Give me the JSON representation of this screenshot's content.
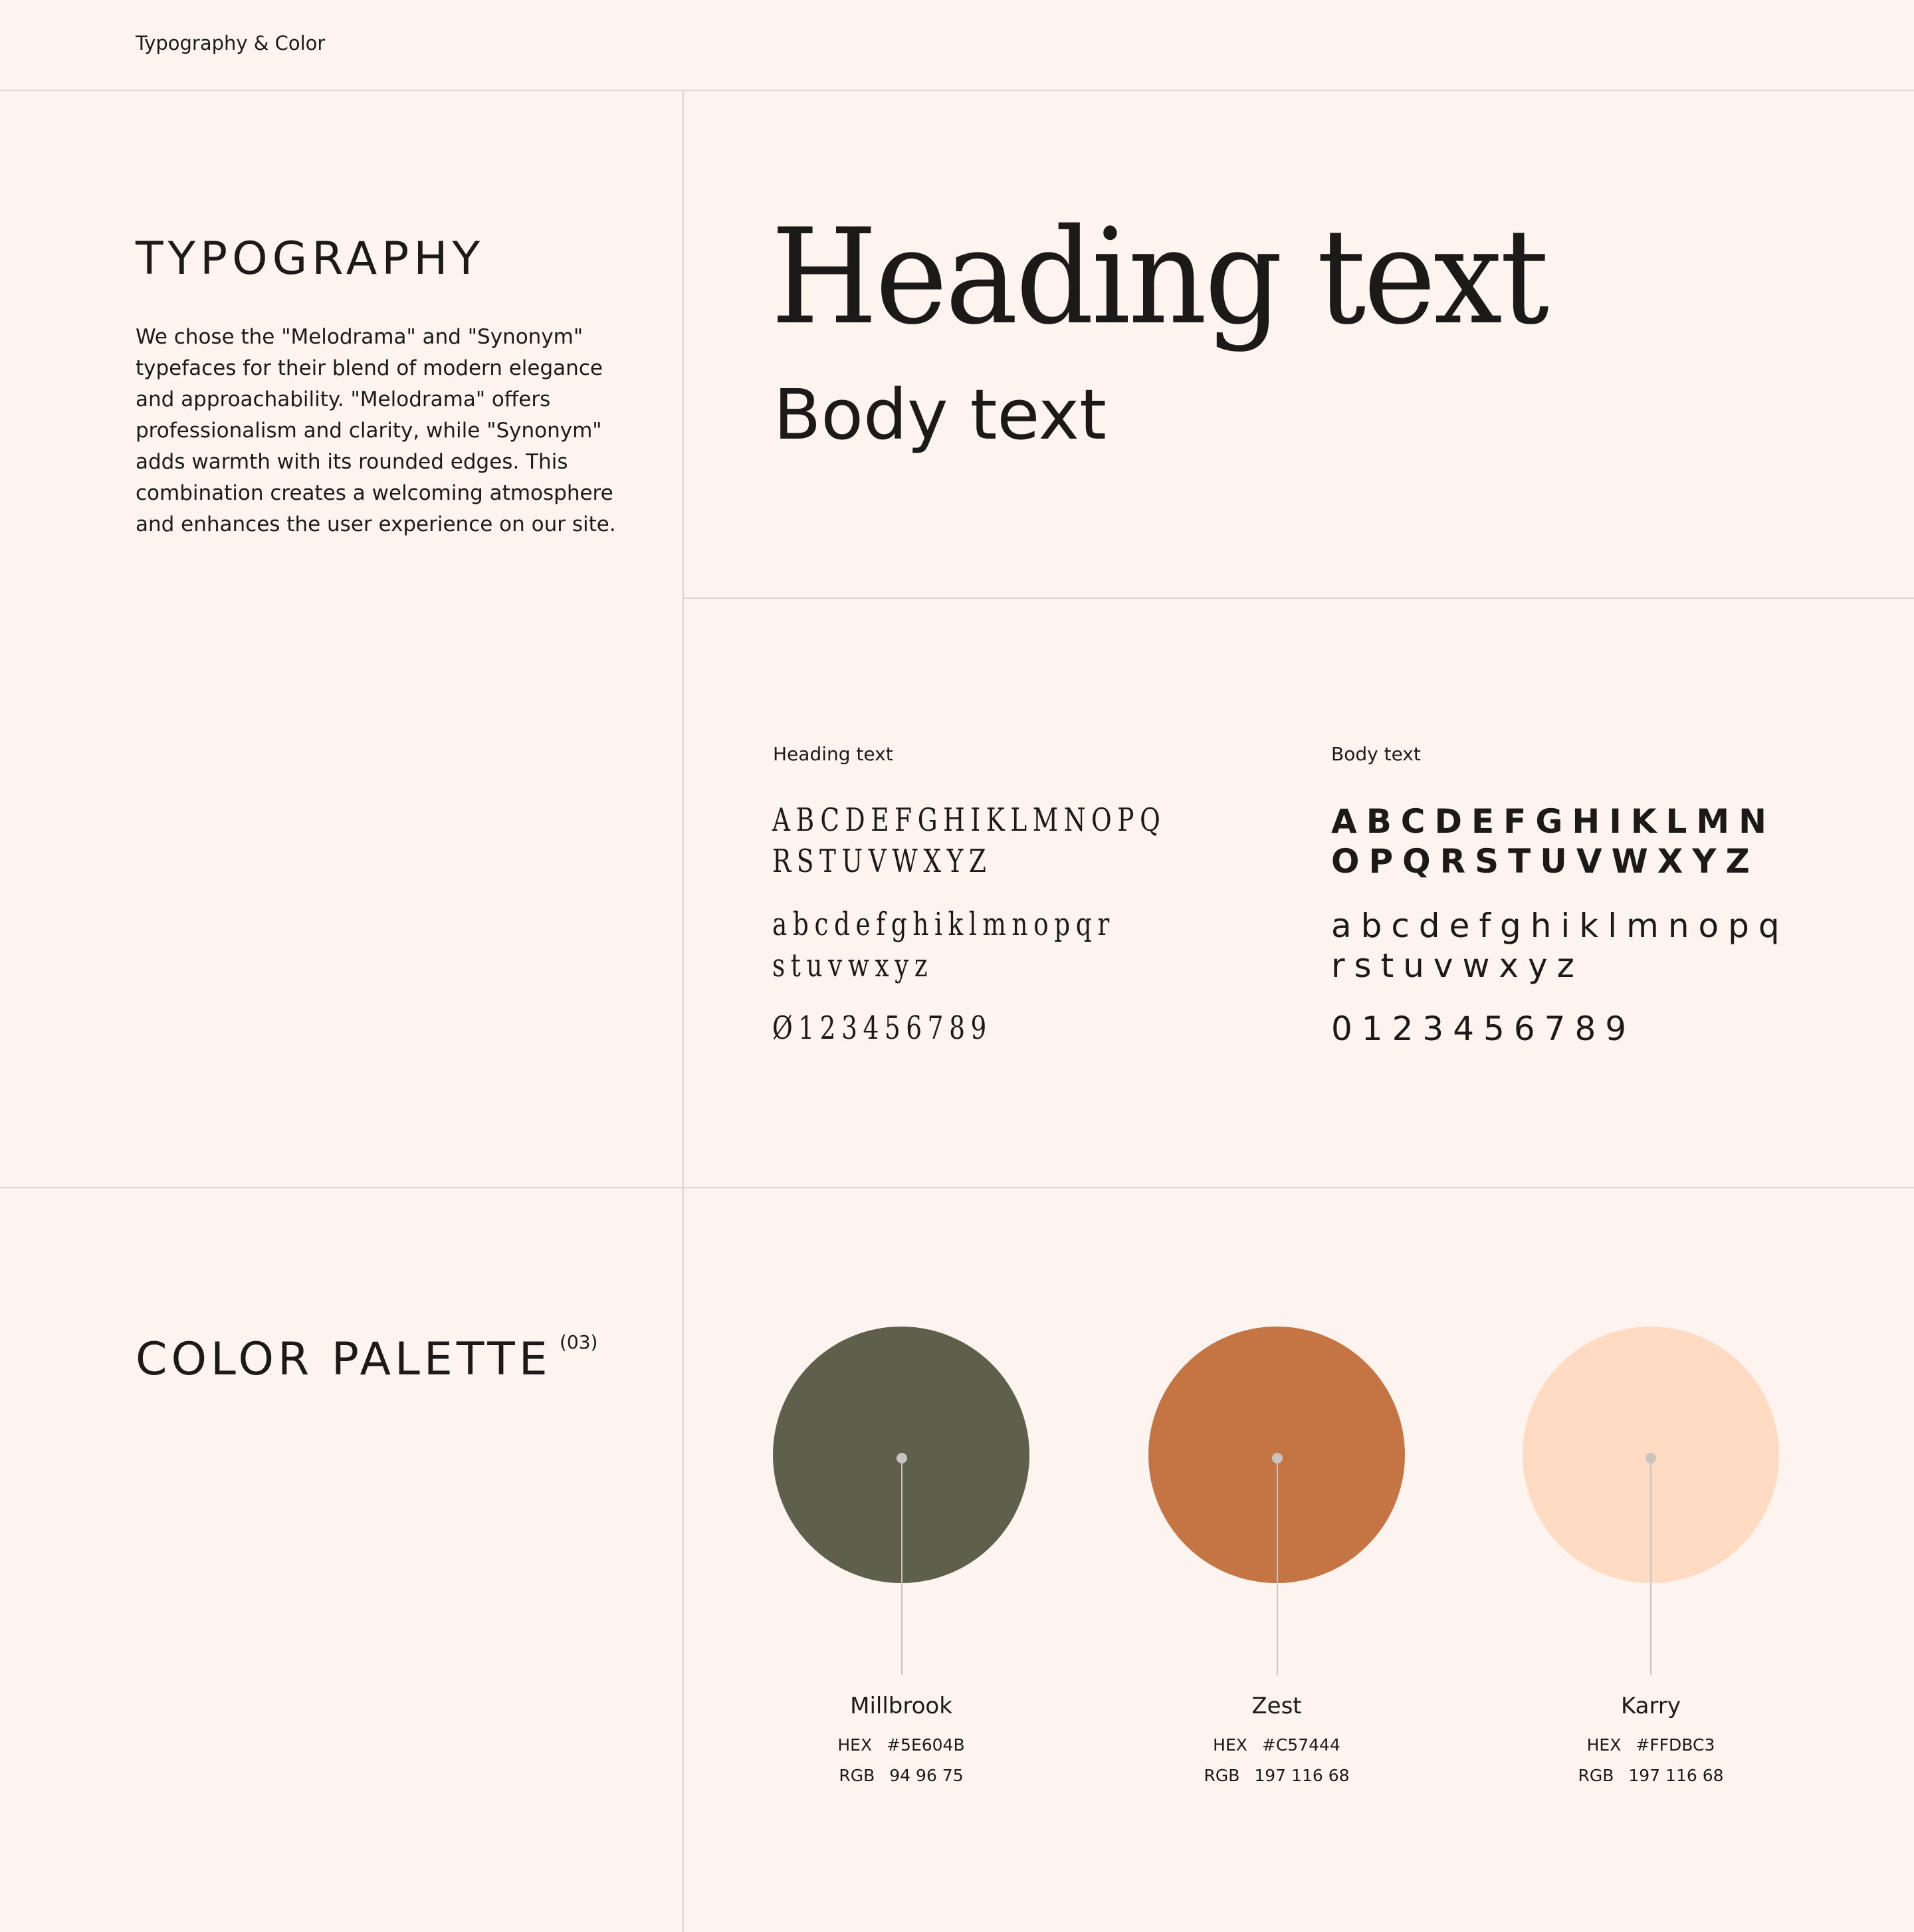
{
  "header": {
    "title": "Typography & Color"
  },
  "typography": {
    "title": "TYPOGRAPHY",
    "description": "We chose the \"Melodrama\" and \"Synonym\" typefaces for their blend of modern elegance and approachability. \"Melodrama\" offers professionalism and clarity, while \"Synonym\" adds warmth with its rounded edges. This combination creates a welcoming atmosphere and enhances the user experience on our site.",
    "heading_sample": "Heading text",
    "body_sample": "Body text",
    "heading_font": {
      "label": "Heading text",
      "upper_line1": "ABCDEFGHIKLMNOPQ",
      "upper_line2": "RSTUVWXYZ",
      "lower_line1": "abcdefghiklmnopqr",
      "lower_line2": "stuvwxyz",
      "digits": "Ø123456789"
    },
    "body_font": {
      "label": "Body text",
      "upper_line1": "ABCDEFGHIKLMN",
      "upper_line2": "OPQRSTUVWXYZ",
      "lower_line1": "abcdefghiklmnopq",
      "lower_line2": "rstuvwxyz",
      "digits": "0123456789"
    }
  },
  "palette": {
    "title": "COLOR PALETTE",
    "count": "(03)",
    "colors": [
      {
        "name": "Millbrook",
        "hex_label": "HEX",
        "hex": "#5E604B",
        "rgb_label": "RGB",
        "rgb": "94 96 75",
        "swatch": "#5E604B"
      },
      {
        "name": "Zest",
        "hex_label": "HEX",
        "hex": "#C57444",
        "rgb_label": "RGB",
        "rgb": "197 116 68",
        "swatch": "#C57444"
      },
      {
        "name": "Karry",
        "hex_label": "HEX",
        "hex": "#FFDBC3",
        "rgb_label": "RGB",
        "rgb": "197 116 68",
        "swatch": "#FFDBC3"
      }
    ]
  },
  "theme": {
    "background": "#FDF4EF",
    "text": "#1C1A18",
    "divider": "#DCD4CE"
  }
}
